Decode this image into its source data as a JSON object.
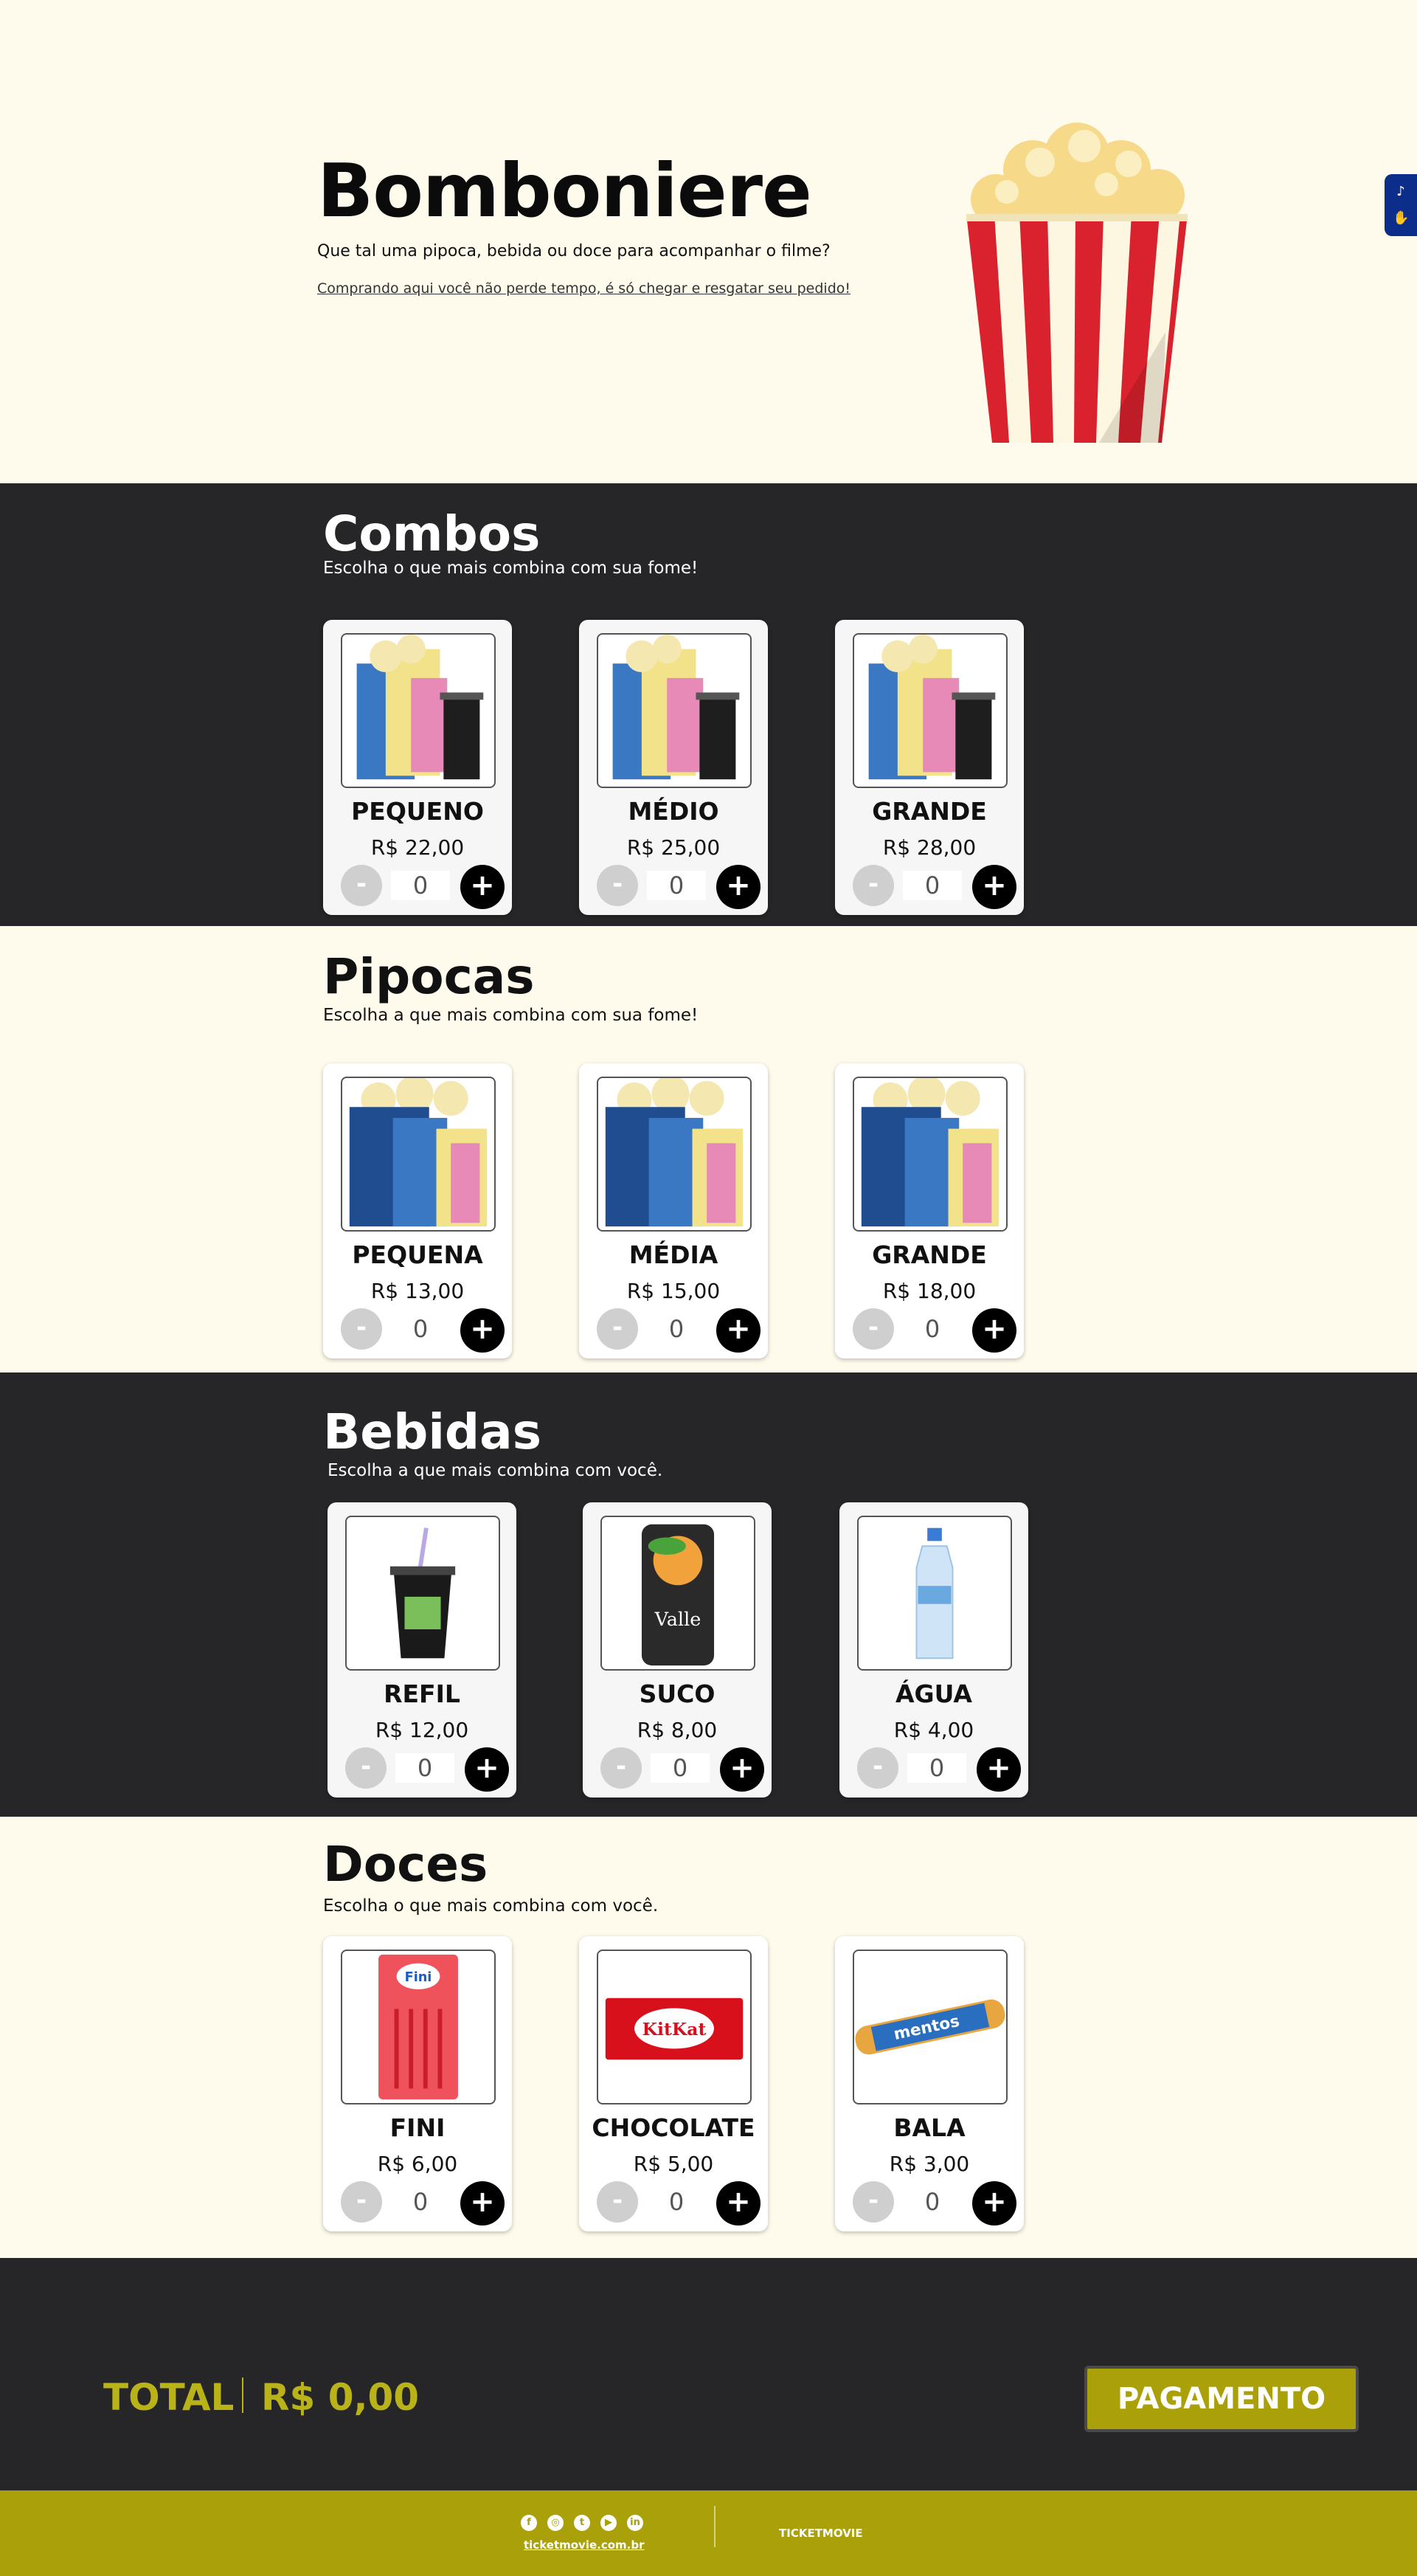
{
  "hero": {
    "title": "Bomboniere",
    "subtitle": "Que tal uma pipoca, bebida ou doce para acompanhar o filme?",
    "link": "Comprando aqui você não perde tempo, é só chegar e resgatar seu pedido!"
  },
  "accessibility": {
    "icons": [
      "audio-icon",
      "hand-sign-icon"
    ]
  },
  "combos": {
    "title": "Combos",
    "subtitle": "Escolha o que mais combina com sua fome!",
    "items": [
      {
        "name": "PEQUENO",
        "price": "R$ 22,00",
        "qty": "0",
        "minus": "-",
        "plus": "+"
      },
      {
        "name": "MÉDIO",
        "price": "R$ 25,00",
        "qty": "0",
        "minus": "-",
        "plus": "+"
      },
      {
        "name": "GRANDE",
        "price": "R$ 28,00",
        "qty": "0",
        "minus": "-",
        "plus": "+"
      }
    ]
  },
  "pipocas": {
    "title": "Pipocas",
    "subtitle": "Escolha a que mais combina com sua fome!",
    "items": [
      {
        "name": "PEQUENA",
        "price": "R$ 13,00",
        "qty": "0",
        "minus": "-",
        "plus": "+"
      },
      {
        "name": "MÉDIA",
        "price": "R$ 15,00",
        "qty": "0",
        "minus": "-",
        "plus": "+"
      },
      {
        "name": "GRANDE",
        "price": "R$ 18,00",
        "qty": "0",
        "minus": "-",
        "plus": "+"
      }
    ]
  },
  "bebidas": {
    "title": "Bebidas",
    "subtitle": "Escolha a que mais combina com você.",
    "items": [
      {
        "name": "REFIL",
        "price": "R$ 12,00",
        "qty": "0",
        "minus": "-",
        "plus": "+"
      },
      {
        "name": "SUCO",
        "price": "R$ 8,00",
        "qty": "0",
        "minus": "-",
        "plus": "+",
        "can_label": "Valle"
      },
      {
        "name": "ÁGUA",
        "price": "R$ 4,00",
        "qty": "0",
        "minus": "-",
        "plus": "+"
      }
    ]
  },
  "doces": {
    "title": "Doces",
    "subtitle": "Escolha o que mais combina com você.",
    "items": [
      {
        "name": "FINI",
        "price": "R$ 6,00",
        "qty": "0",
        "minus": "-",
        "plus": "+",
        "pack_label": "Fini"
      },
      {
        "name": "CHOCOLATE",
        "price": "R$ 5,00",
        "qty": "0",
        "minus": "-",
        "plus": "+",
        "pack_label": "KitKat"
      },
      {
        "name": "BALA",
        "price": "R$ 3,00",
        "qty": "0",
        "minus": "-",
        "plus": "+",
        "pack_label": "mentos"
      }
    ]
  },
  "total": {
    "label": "TOTAL",
    "value": "R$ 0,00",
    "pay_button": "PAGAMENTO"
  },
  "footer": {
    "social": [
      "f",
      "◎",
      "t",
      "▶",
      "in"
    ],
    "site": "ticketmovie.com.br",
    "brand": "TICKETMOVIE"
  },
  "colors": {
    "accent": "#a9a00a",
    "dark": "#262628",
    "cream": "#fffbec",
    "accessibility": "#0c2e8a"
  }
}
